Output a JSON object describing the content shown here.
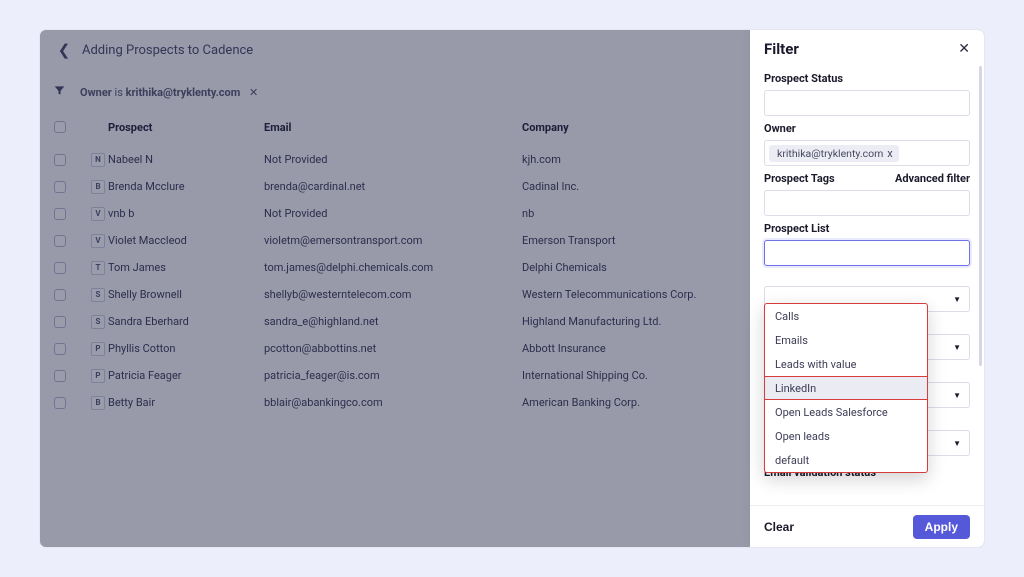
{
  "header": {
    "title": "Adding Prospects to Cadence"
  },
  "filterbar": {
    "owner_key": "Owner",
    "owner_op": "is",
    "owner_val": "krithika@tryklenty.com"
  },
  "columns": {
    "prospect": "Prospect",
    "email": "Email",
    "company": "Company"
  },
  "rows": [
    {
      "initial": "N",
      "name": "Nabeel N",
      "email": "Not Provided",
      "company": "kjh.com"
    },
    {
      "initial": "B",
      "name": "Brenda Mcclure",
      "email": "brenda@cardinal.net",
      "company": "Cadinal Inc."
    },
    {
      "initial": "V",
      "name": "vnb b",
      "email": "Not Provided",
      "company": "nb"
    },
    {
      "initial": "V",
      "name": "Violet Maccleod",
      "email": "violetm@emersontransport.com",
      "company": "Emerson Transport"
    },
    {
      "initial": "T",
      "name": "Tom James",
      "email": "tom.james@delphi.chemicals.com",
      "company": "Delphi Chemicals"
    },
    {
      "initial": "S",
      "name": "Shelly Brownell",
      "email": "shellyb@westerntelecom.com",
      "company": "Western Telecommunications Corp."
    },
    {
      "initial": "S",
      "name": "Sandra Eberhard",
      "email": "sandra_e@highland.net",
      "company": "Highland Manufacturing Ltd."
    },
    {
      "initial": "P",
      "name": "Phyllis Cotton",
      "email": "pcotton@abbottins.net",
      "company": "Abbott Insurance"
    },
    {
      "initial": "P",
      "name": "Patricia Feager",
      "email": "patricia_feager@is.com",
      "company": "International Shipping Co."
    },
    {
      "initial": "B",
      "name": "Betty Bair",
      "email": "bblair@abankingco.com",
      "company": "American Banking Corp."
    }
  ],
  "filter": {
    "title": "Filter",
    "labels": {
      "prospect_status": "Prospect Status",
      "owner": "Owner",
      "prospect_tags": "Prospect Tags",
      "advanced": "Advanced filter",
      "prospect_list": "Prospect List",
      "email_validation": "Email validation status"
    },
    "owner_chip": "krithika@tryklenty.com",
    "owner_chip_x": "x",
    "dropdown": [
      "Calls",
      "Emails",
      "Leads with value",
      "LinkedIn",
      "Open Leads Salesforce",
      "Open leads",
      "default"
    ],
    "buttons": {
      "clear": "Clear",
      "apply": "Apply"
    }
  }
}
